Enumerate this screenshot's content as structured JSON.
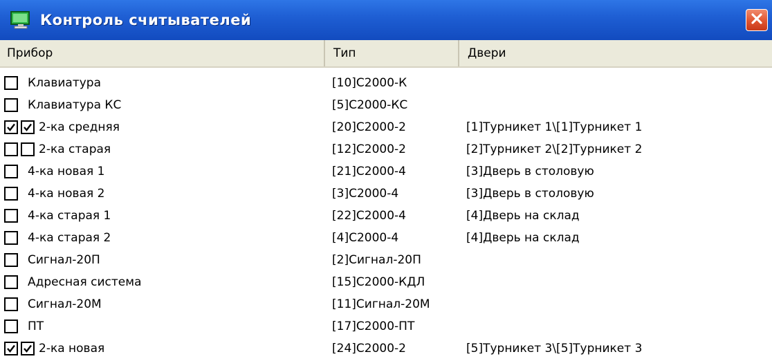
{
  "window": {
    "title": "Контроль считывателей",
    "icon": "monitor-icon",
    "close_icon": "close-icon",
    "accent": "#1f5fd4",
    "close_color": "#e0542f"
  },
  "columns": {
    "device": "Прибор",
    "type": "Тип",
    "doors": "Двери"
  },
  "rows": [
    {
      "name": "Клавиатура",
      "type": "[10]С2000-К",
      "doors": "",
      "checks": [
        false
      ]
    },
    {
      "name": "Клавиатура КС",
      "type": "[5]С2000-КС",
      "doors": "",
      "checks": [
        false
      ]
    },
    {
      "name": "2-ка средняя",
      "type": "[20]С2000-2",
      "doors": "[1]Турникет 1\\[1]Турникет 1",
      "checks": [
        true,
        true
      ]
    },
    {
      "name": "2-ка старая",
      "type": "[12]С2000-2",
      "doors": "[2]Турникет 2\\[2]Турникет 2",
      "checks": [
        false,
        false
      ]
    },
    {
      "name": "4-ка новая 1",
      "type": "[21]С2000-4",
      "doors": "[3]Дверь в столовую",
      "checks": [
        false
      ]
    },
    {
      "name": "4-ка новая 2",
      "type": "[3]С2000-4",
      "doors": "[3]Дверь в столовую",
      "checks": [
        false
      ]
    },
    {
      "name": "4-ка старая 1",
      "type": "[22]С2000-4",
      "doors": "[4]Дверь на склад",
      "checks": [
        false
      ]
    },
    {
      "name": "4-ка старая 2",
      "type": "[4]С2000-4",
      "doors": "[4]Дверь на склад",
      "checks": [
        false
      ]
    },
    {
      "name": "Сигнал-20П",
      "type": "[2]Сигнал-20П",
      "doors": "",
      "checks": [
        false
      ]
    },
    {
      "name": "Адресная система",
      "type": "[15]С2000-КДЛ",
      "doors": "",
      "checks": [
        false
      ]
    },
    {
      "name": "Сигнал-20М",
      "type": "[11]Сигнал-20М",
      "doors": "",
      "checks": [
        false
      ]
    },
    {
      "name": "ПТ",
      "type": "[17]С2000-ПТ",
      "doors": "",
      "checks": [
        false
      ]
    },
    {
      "name": "2-ка новая",
      "type": "[24]С2000-2",
      "doors": "[5]Турникет 3\\[5]Турникет 3",
      "checks": [
        true,
        true
      ]
    }
  ]
}
